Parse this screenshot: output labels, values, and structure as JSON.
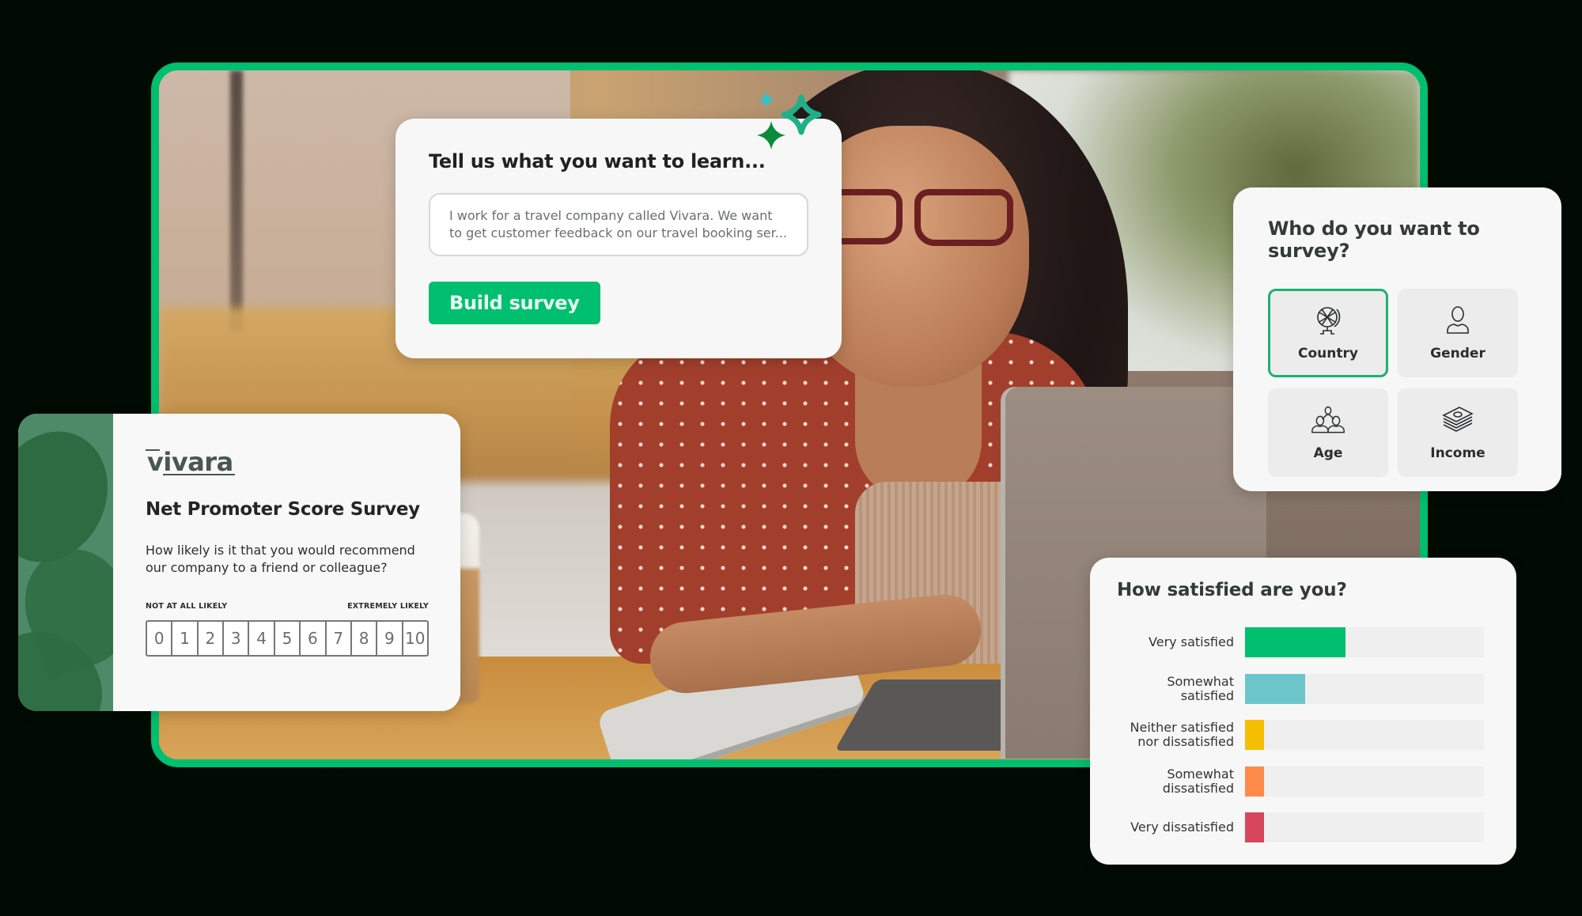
{
  "learn_card": {
    "title": "Tell us what you want to learn...",
    "input_text": "I work for a travel company called Vivara. We want to get customer feedback on our travel booking ser...",
    "button_label": "Build survey",
    "sparkle_icon": "sparkle-icon"
  },
  "who_card": {
    "title": "Who do you want to survey?",
    "options": [
      {
        "label": "Country",
        "icon": "globe-icon",
        "selected": true
      },
      {
        "label": "Gender",
        "icon": "person-icon",
        "selected": false
      },
      {
        "label": "Age",
        "icon": "group-icon",
        "selected": false
      },
      {
        "label": "Income",
        "icon": "money-icon",
        "selected": false
      }
    ]
  },
  "nps_card": {
    "logo": "vivara",
    "title": "Net Promoter Score Survey",
    "question": "How likely is it that you would recommend our company to a friend or colleague?",
    "low_label": "NOT AT ALL LIKELY",
    "high_label": "EXTREMELY LIKELY",
    "scale": [
      "0",
      "1",
      "2",
      "3",
      "4",
      "5",
      "6",
      "7",
      "8",
      "9",
      "10"
    ]
  },
  "satisfaction_card": {
    "title": "How satisfied are you?"
  },
  "colors": {
    "brand_green": "#00bf6f",
    "very_satisfied": "#00bf6f",
    "somewhat_satisfied": "#6cc5cb",
    "neutral": "#f5be00",
    "somewhat_dissatisfied": "#ff8b4a",
    "very_dissatisfied": "#d7465b"
  },
  "chart_data": {
    "type": "bar",
    "orientation": "horizontal",
    "title": "How satisfied are you?",
    "categories": [
      "Very satisfied",
      "Somewhat satisfied",
      "Neither satisfied nor dissatisfied",
      "Somewhat dissatisfied",
      "Very dissatisfied"
    ],
    "values": [
      42,
      25,
      8,
      8,
      8
    ],
    "units": "percent",
    "xlim": [
      0,
      100
    ],
    "colors": [
      "#00bf6f",
      "#6cc5cb",
      "#f5be00",
      "#ff8b4a",
      "#d7465b"
    ],
    "grid": false,
    "legend": "none"
  }
}
